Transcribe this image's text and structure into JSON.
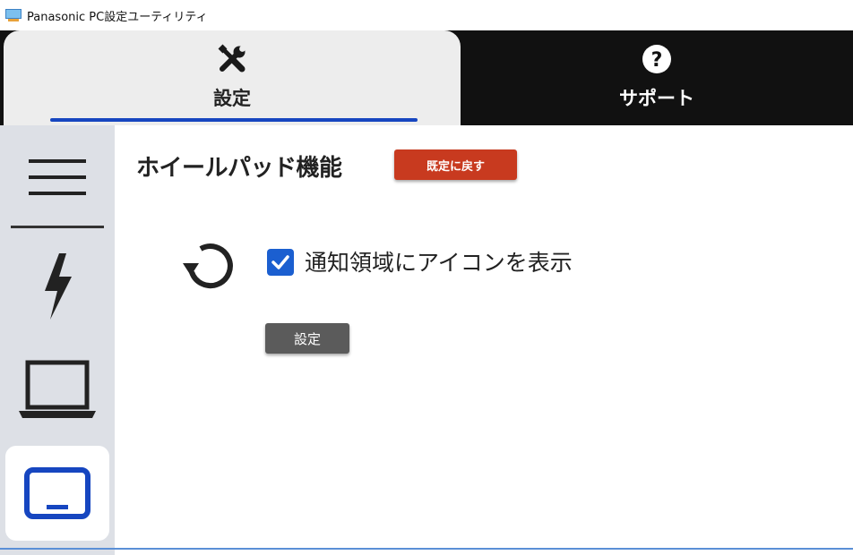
{
  "window": {
    "title": "Panasonic PC設定ユーティリティ"
  },
  "tabs": [
    {
      "label": "設定",
      "icon": "tools-icon",
      "selected": true
    },
    {
      "label": "サポート",
      "icon": "help-circle-icon",
      "selected": false
    }
  ],
  "sidebar": {
    "items": [
      {
        "icon": "menu-icon"
      },
      {
        "icon": "lightning-icon"
      },
      {
        "icon": "laptop-icon"
      },
      {
        "icon": "display-icon",
        "selected": true
      }
    ]
  },
  "main": {
    "title": "ホイールパッド機能",
    "reset_label": "既定に戻す",
    "checkbox": {
      "label": "通知領域にアイコンを表示",
      "checked": true
    },
    "apply_label": "設定"
  },
  "colors": {
    "tab_bar": "#111111",
    "selected_tab": "#ededed",
    "accent_blue": "#1646c0",
    "reset_button": "#c83a1f",
    "apply_button": "#5b5b5b",
    "sidebar": "#dde0e6"
  }
}
